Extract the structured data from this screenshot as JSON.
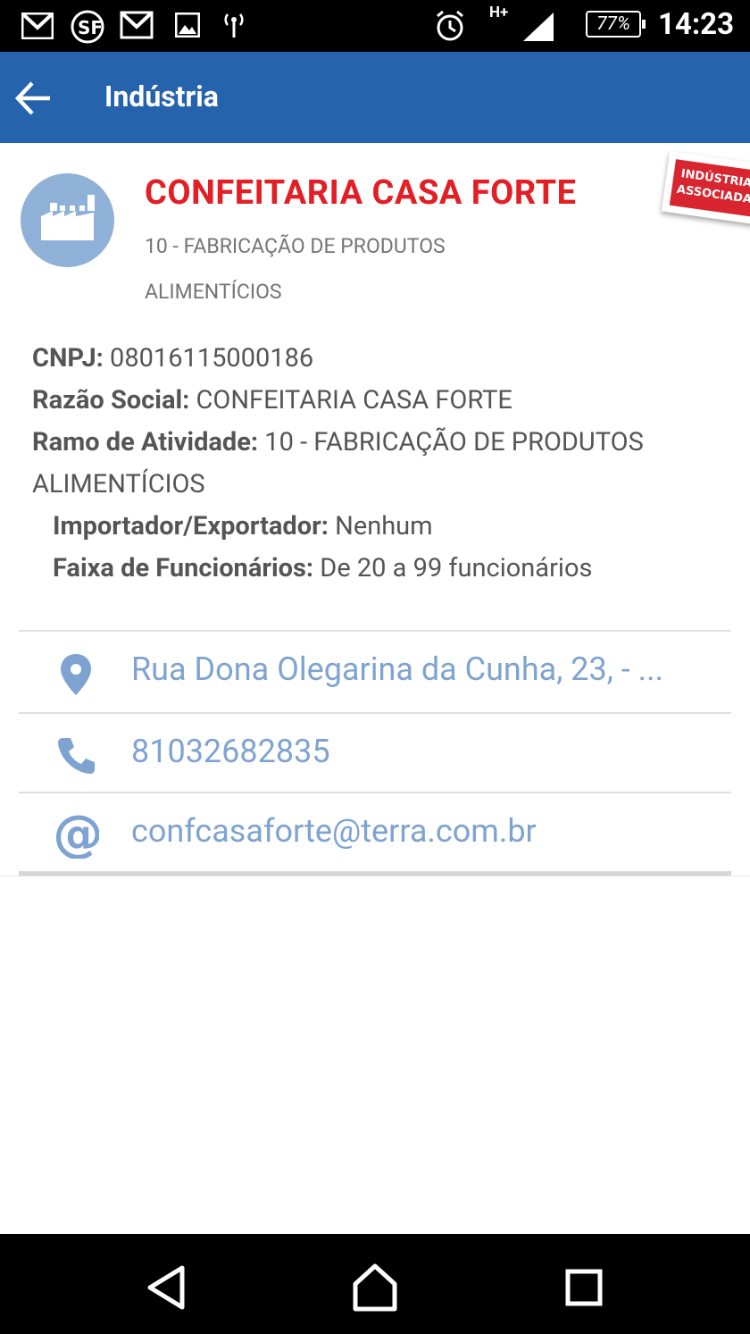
{
  "status_bar": {
    "time": "14:23",
    "battery": "77%",
    "network": "H+",
    "icons": [
      "gmail-icon",
      "sf-icon",
      "gmail-icon",
      "image-icon",
      "hotspot-icon",
      "alarm-icon",
      "signal-icon",
      "battery-icon"
    ]
  },
  "app_bar": {
    "title": "Indústria",
    "background": "#2563ad"
  },
  "company": {
    "name": "CONFEITARIA CASA FORTE",
    "sector": "10 - FABRICAÇÃO DE PRODUTOS ALIMENTÍCIOS",
    "badge_line1": "INDÚSTRIA",
    "badge_line2": "ASSOCIADA",
    "name_color": "#e31e24"
  },
  "details": {
    "cnpj_label": "CNPJ:",
    "cnpj_value": "08016115000186",
    "razao_label": "Razão Social:",
    "razao_value": "CONFEITARIA CASA FORTE",
    "ramo_label": "Ramo de Atividade:",
    "ramo_value": "10 - FABRICAÇÃO DE PRODUTOS ALIMENTÍCIOS",
    "importador_label": "Importador/Exportador:",
    "importador_value": "Nenhum",
    "faixa_label": "Faixa de Funcionários:",
    "faixa_value": "De 20 a 99 funcionários"
  },
  "contacts": {
    "address": "Rua Dona Olegarina da Cunha, 23, - ...",
    "phone": "81032682835",
    "email": "confcasaforte@terra.com.br",
    "link_color": "#7ea3d1"
  }
}
